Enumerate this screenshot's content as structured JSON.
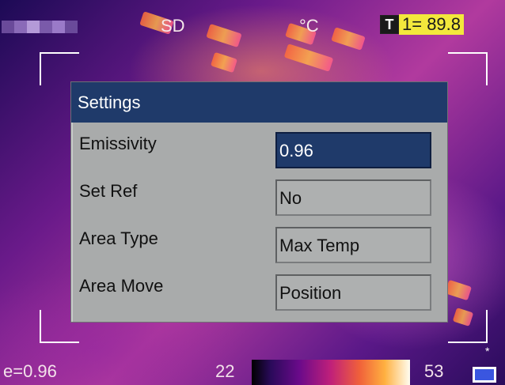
{
  "status_bar": {
    "storage": "SD",
    "unit": "°C",
    "readout_icon": "T",
    "readout": "1= 89.8"
  },
  "dialog": {
    "title": "Settings",
    "rows": [
      {
        "label": "Emissivity",
        "value": "0.96"
      },
      {
        "label": "Set Ref",
        "value": "No"
      },
      {
        "label": "Area Type",
        "value": "Max Temp"
      },
      {
        "label": "Area Move",
        "value": "Position"
      }
    ]
  },
  "bottom_bar": {
    "emissivity": "e=0.96",
    "scale_min": "22",
    "scale_max": "53"
  },
  "colors": {
    "dialog_title_bg": "#1f3a6a",
    "dialog_bg": "#a9abab",
    "readout_bg": "#f3e83c",
    "selected_field_bg": "#1f3a6a"
  }
}
